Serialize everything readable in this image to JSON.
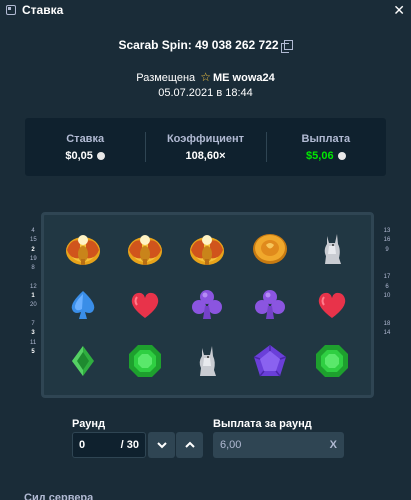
{
  "modal": {
    "title": "Ставка",
    "close_icon": "close-icon"
  },
  "spin": {
    "label": "Scarab Spin: 49 038 262 722",
    "copy_icon": "copy-icon"
  },
  "placed": {
    "prefix": "Размещена",
    "star_icon": "star-icon",
    "username": "ME wowa24",
    "date": "05.07.2021 в 18:44"
  },
  "stats": {
    "bet_label": "Ставка",
    "bet_value": "$0,05",
    "multiplier_label": "Коэффициент",
    "multiplier_value": "108,60×",
    "payout_label": "Выплата",
    "payout_value": "$5,06",
    "payout_color": "#00e701"
  },
  "paylines": {
    "left": [
      "4",
      "15",
      "2",
      "19",
      "8",
      "",
      "12",
      "1",
      "20",
      "",
      "7",
      "3",
      "11",
      "5"
    ],
    "right": [
      "13",
      "16",
      "9",
      "",
      "",
      "17",
      "6",
      "10",
      "",
      "",
      "18",
      "14"
    ]
  },
  "reels": {
    "rows": [
      [
        "scarab",
        "scarab",
        "scarab",
        "coin",
        "anubis-dog"
      ],
      [
        "spade",
        "heart",
        "club",
        "club",
        "heart"
      ],
      [
        "diamond",
        "emerald",
        "anubis-dog",
        "pentagon-gem",
        "emerald"
      ]
    ]
  },
  "round": {
    "label": "Раунд",
    "current": "0",
    "total": "/ 30",
    "down_icon": "chevron-down-icon",
    "up_icon": "chevron-up-icon"
  },
  "round_payout": {
    "label": "Выплата за раунд",
    "value": "6,00",
    "suffix": "X"
  },
  "footer": {
    "text": "Сид сервера"
  }
}
